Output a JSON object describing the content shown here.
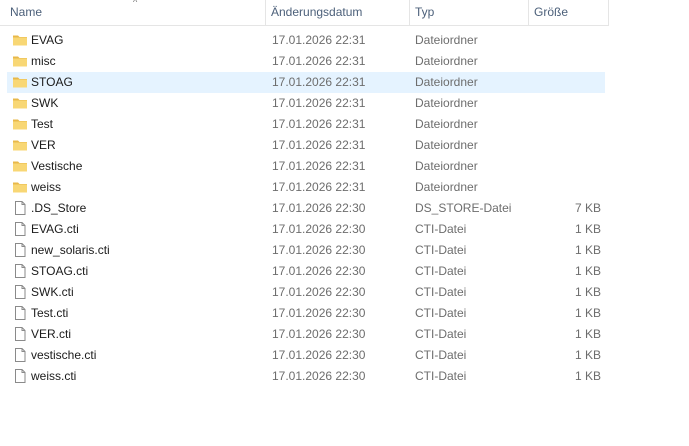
{
  "columns": {
    "name": "Name",
    "date": "Änderungsdatum",
    "type": "Typ",
    "size": "Größe"
  },
  "sort_indicator": "^",
  "selected_index": 2,
  "files": [
    {
      "name": "EVAG",
      "date": "17.01.2026 22:31",
      "type": "Dateiordner",
      "size": "",
      "icon": "folder-icon"
    },
    {
      "name": "misc",
      "date": "17.01.2026 22:31",
      "type": "Dateiordner",
      "size": "",
      "icon": "folder-icon"
    },
    {
      "name": "STOAG",
      "date": "17.01.2026 22:31",
      "type": "Dateiordner",
      "size": "",
      "icon": "folder-icon"
    },
    {
      "name": "SWK",
      "date": "17.01.2026 22:31",
      "type": "Dateiordner",
      "size": "",
      "icon": "folder-icon"
    },
    {
      "name": "Test",
      "date": "17.01.2026 22:31",
      "type": "Dateiordner",
      "size": "",
      "icon": "folder-icon"
    },
    {
      "name": "VER",
      "date": "17.01.2026 22:31",
      "type": "Dateiordner",
      "size": "",
      "icon": "folder-icon"
    },
    {
      "name": "Vestische",
      "date": "17.01.2026 22:31",
      "type": "Dateiordner",
      "size": "",
      "icon": "folder-icon"
    },
    {
      "name": "weiss",
      "date": "17.01.2026 22:31",
      "type": "Dateiordner",
      "size": "",
      "icon": "folder-icon"
    },
    {
      "name": ".DS_Store",
      "date": "17.01.2026 22:30",
      "type": "DS_STORE-Datei",
      "size": "7 KB",
      "icon": "file-icon"
    },
    {
      "name": "EVAG.cti",
      "date": "17.01.2026 22:30",
      "type": "CTI-Datei",
      "size": "1 KB",
      "icon": "file-icon"
    },
    {
      "name": "new_solaris.cti",
      "date": "17.01.2026 22:30",
      "type": "CTI-Datei",
      "size": "1 KB",
      "icon": "file-icon"
    },
    {
      "name": "STOAG.cti",
      "date": "17.01.2026 22:30",
      "type": "CTI-Datei",
      "size": "1 KB",
      "icon": "file-icon"
    },
    {
      "name": "SWK.cti",
      "date": "17.01.2026 22:30",
      "type": "CTI-Datei",
      "size": "1 KB",
      "icon": "file-icon"
    },
    {
      "name": "Test.cti",
      "date": "17.01.2026 22:30",
      "type": "CTI-Datei",
      "size": "1 KB",
      "icon": "file-icon"
    },
    {
      "name": "VER.cti",
      "date": "17.01.2026 22:30",
      "type": "CTI-Datei",
      "size": "1 KB",
      "icon": "file-icon"
    },
    {
      "name": "vestische.cti",
      "date": "17.01.2026 22:30",
      "type": "CTI-Datei",
      "size": "1 KB",
      "icon": "file-icon"
    },
    {
      "name": "weiss.cti",
      "date": "17.01.2026 22:30",
      "type": "CTI-Datei",
      "size": "1 KB",
      "icon": "file-icon"
    }
  ],
  "colors": {
    "folder": "#f8d775",
    "folder_dark": "#e8b84a",
    "selected_row": "#e5f3ff",
    "header_text": "#4c607a"
  }
}
